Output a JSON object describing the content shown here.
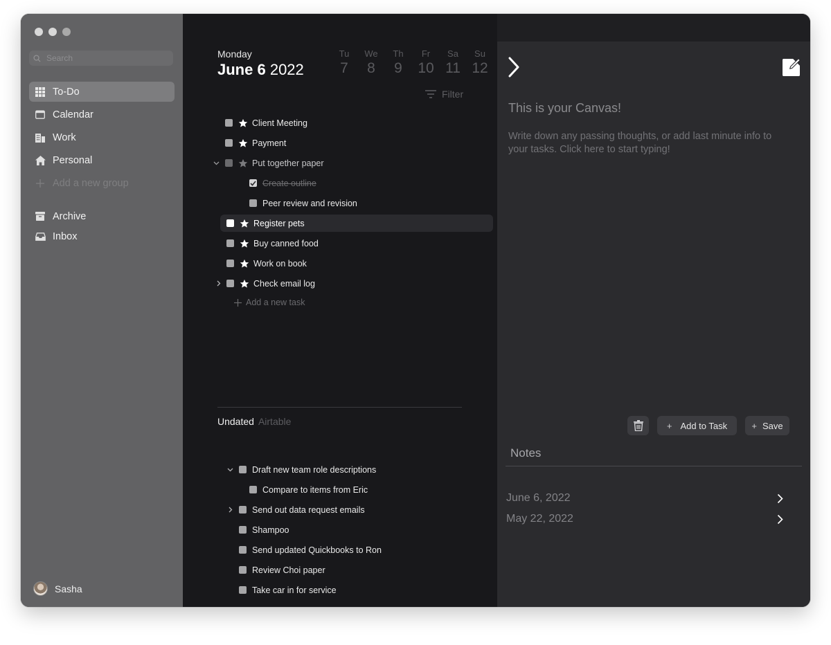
{
  "sidebar": {
    "search_placeholder": "Search",
    "items": [
      {
        "label": "To-Do"
      },
      {
        "label": "Calendar"
      },
      {
        "label": "Work"
      },
      {
        "label": "Personal"
      },
      {
        "label": "Add a new group"
      },
      {
        "label": "Archive"
      },
      {
        "label": "Inbox"
      }
    ],
    "user": {
      "name": "Sasha"
    }
  },
  "header": {
    "day_name": "Monday",
    "date_bold": "June 6",
    "year": "2022",
    "week": [
      {
        "day": "Tu",
        "num": "7"
      },
      {
        "day": "We",
        "num": "8"
      },
      {
        "day": "Th",
        "num": "9"
      },
      {
        "day": "Fr",
        "num": "10"
      },
      {
        "day": "Sa",
        "num": "11"
      },
      {
        "day": "Su",
        "num": "12"
      }
    ],
    "filter_label": "Filter"
  },
  "tasks": [
    {
      "label": "Client Meeting"
    },
    {
      "label": "Payment"
    },
    {
      "label": "Put together paper"
    },
    {
      "label": "Create outline"
    },
    {
      "label": "Peer review and revision"
    },
    {
      "label": "Register pets"
    },
    {
      "label": "Buy canned food"
    },
    {
      "label": "Work on book"
    },
    {
      "label": "Check email log"
    }
  ],
  "add_task_label": "Add a new task",
  "undated": {
    "title": "Undated",
    "source": "Airtable",
    "tasks": [
      {
        "label": "Draft new team role descriptions"
      },
      {
        "label": "Compare to items from Eric"
      },
      {
        "label": "Send out data request emails"
      },
      {
        "label": "Shampoo"
      },
      {
        "label": "Send updated Quickbooks to Ron"
      },
      {
        "label": "Review Choi paper"
      },
      {
        "label": "Take car in for service"
      }
    ]
  },
  "canvas": {
    "title": "This is your Canvas!",
    "body": "Write down any passing thoughts, or add last minute info to your tasks. Click here to start typing!",
    "add_to_task_label": "Add to Task",
    "save_label": "Save"
  },
  "notes": {
    "title": "Notes",
    "items": [
      {
        "date": "June 6, 2022"
      },
      {
        "date": "May 22, 2022"
      }
    ]
  },
  "colors": {
    "sidebar_bg": "#626264",
    "list_bg": "#18181b",
    "canvas_bg": "#2b2b2e",
    "active_item": "#7d7d7f"
  }
}
